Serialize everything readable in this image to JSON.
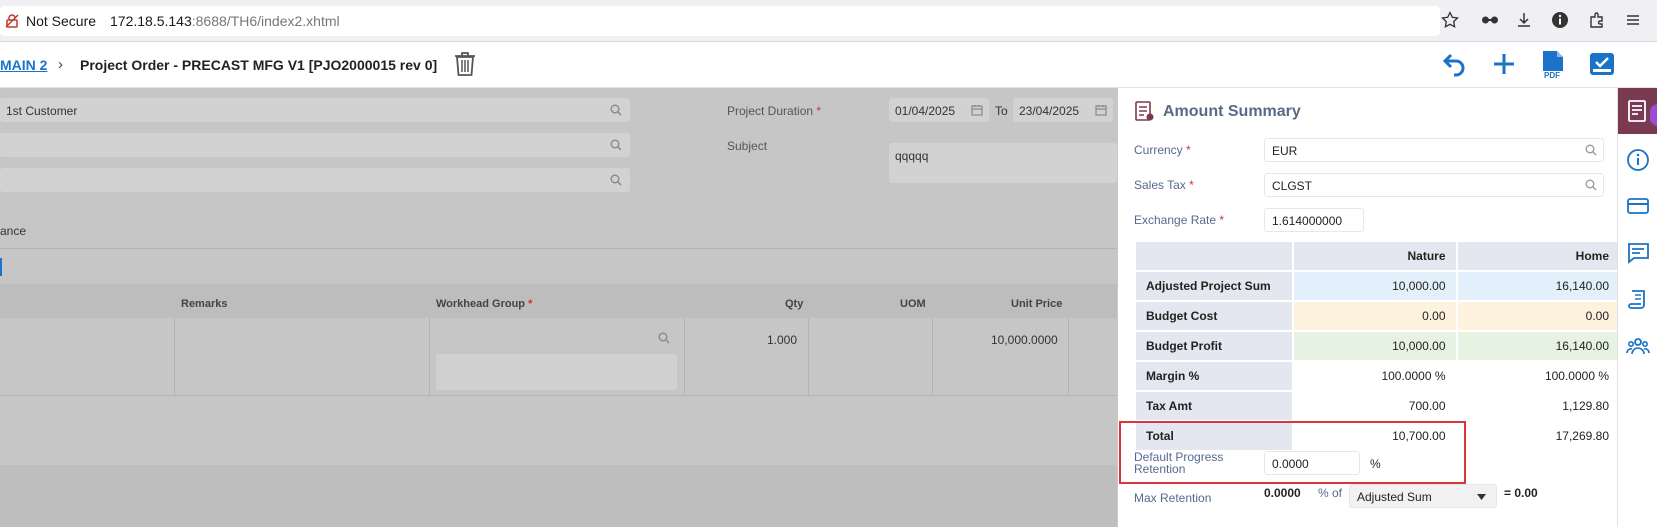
{
  "browser": {
    "security_label": "Not Secure",
    "url_host": "172.18.5.143",
    "url_rest": ":8688/TH6/index2.xhtml"
  },
  "header": {
    "breadcrumb_link": "MAIN 2",
    "title": "Project Order - PRECAST MFG V1 [PJO2000015 rev 0]"
  },
  "form": {
    "customer_value": "1st Customer",
    "project_duration_label": "Project Duration",
    "date_from": "01/04/2025",
    "to_label": "To",
    "date_to": "23/04/2025",
    "subject_label": "Subject",
    "subject_value": "qqqqq",
    "partial_label": "ance"
  },
  "table": {
    "columns": [
      "Remarks",
      "Workhead Group",
      "Qty",
      "UOM",
      "Unit Price"
    ],
    "row": {
      "qty": "1.000",
      "unit_price": "10,000.0000"
    }
  },
  "summary": {
    "title": "Amount Summary",
    "currency_label": "Currency",
    "currency_value": "EUR",
    "sales_tax_label": "Sales Tax",
    "sales_tax_value": "CLGST",
    "exchange_rate_label": "Exchange Rate",
    "exchange_rate_value": "1.614000000",
    "col_nature": "Nature",
    "col_home": "Home",
    "rows": [
      {
        "label": "Adjusted Project Sum",
        "nature": "10,000.00",
        "home": "16,140.00",
        "bg": "#e3effb"
      },
      {
        "label": "Budget Cost",
        "nature": "0.00",
        "home": "0.00",
        "bg": "#fdf2dd"
      },
      {
        "label": "Budget Profit",
        "nature": "10,000.00",
        "home": "16,140.00",
        "bg": "#e6f2e2"
      },
      {
        "label": "Margin %",
        "nature": "100.0000 %",
        "home": "100.0000 %",
        "bg": "#ffffff"
      },
      {
        "label": "Tax Amt",
        "nature": "700.00",
        "home": "1,129.80",
        "bg": "#ffffff"
      },
      {
        "label": "Total",
        "nature": "10,700.00",
        "home": "17,269.80",
        "bg": "#ffffff"
      }
    ],
    "retention_label_1": "Default Progress",
    "retention_label_2": "Retention",
    "retention_value": "0.0000",
    "retention_unit": "%",
    "max_retention_label": "Max Retention",
    "max_retention_value": "0.0000",
    "pct_of_label": "% of",
    "basis_value": "Adjusted Sum",
    "equals_label": "= 0.00"
  },
  "colors": {
    "accent": "#1a73c8",
    "panel_label": "#556a90",
    "rail_active": "#7a3a52",
    "highlight": "#d9353a",
    "row_label_bg": "#e4e7ef"
  }
}
